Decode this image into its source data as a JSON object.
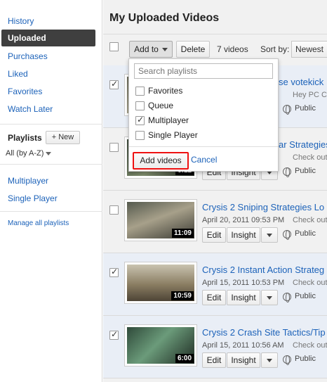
{
  "sidebar": {
    "nav": [
      "History",
      "Uploaded",
      "Purchases",
      "Liked",
      "Favorites",
      "Watch Later"
    ],
    "playlists_heading": "Playlists",
    "new_button": "+ New",
    "sort": "All (by A-Z)",
    "playlists": [
      "Multiplayer",
      "Single Player"
    ],
    "manage": "Manage all playlists"
  },
  "main": {
    "title": "My Uploaded Videos",
    "add_to": "Add to",
    "delete": "Delete",
    "count": "7 videos",
    "sort_by": "Sort by:",
    "sort_value": "Newest"
  },
  "dropdown": {
    "placeholder": "Search playlists",
    "options": [
      {
        "label": "Favorites",
        "checked": false
      },
      {
        "label": "Queue",
        "checked": false
      },
      {
        "label": "Multiplayer",
        "checked": true
      },
      {
        "label": "Single Player",
        "checked": false
      }
    ],
    "add_videos": "Add videos",
    "cancel": "Cancel"
  },
  "videos": [
    {
      "title": "se votekick",
      "date": "",
      "check": "Hey PC Crys",
      "duration": "",
      "checked": true
    },
    {
      "title": "ar Strategies",
      "date": "",
      "check": "Check out",
      "duration": "6:12",
      "checked": false
    },
    {
      "title": "Crysis 2 Sniping Strategies Lo",
      "date": "April 20, 2011 09:53 PM",
      "check": "Check out",
      "duration": "11:09",
      "checked": false
    },
    {
      "title": "Crysis 2 Instant Action Strateg",
      "date": "April 15, 2011 10:53 PM",
      "check": "Check out",
      "duration": "10:59",
      "checked": true
    },
    {
      "title": "Crysis 2 Crash Site Tactics/Tip",
      "date": "April 15, 2011 10:56 AM",
      "check": "Check out",
      "duration": "6:00",
      "checked": true
    }
  ],
  "row_labels": {
    "edit": "Edit",
    "insight": "Insight",
    "public": "Public"
  },
  "colors": {
    "link": "#1c62b9",
    "selected_nav": "#3f3f3f",
    "highlight": "#e11"
  }
}
